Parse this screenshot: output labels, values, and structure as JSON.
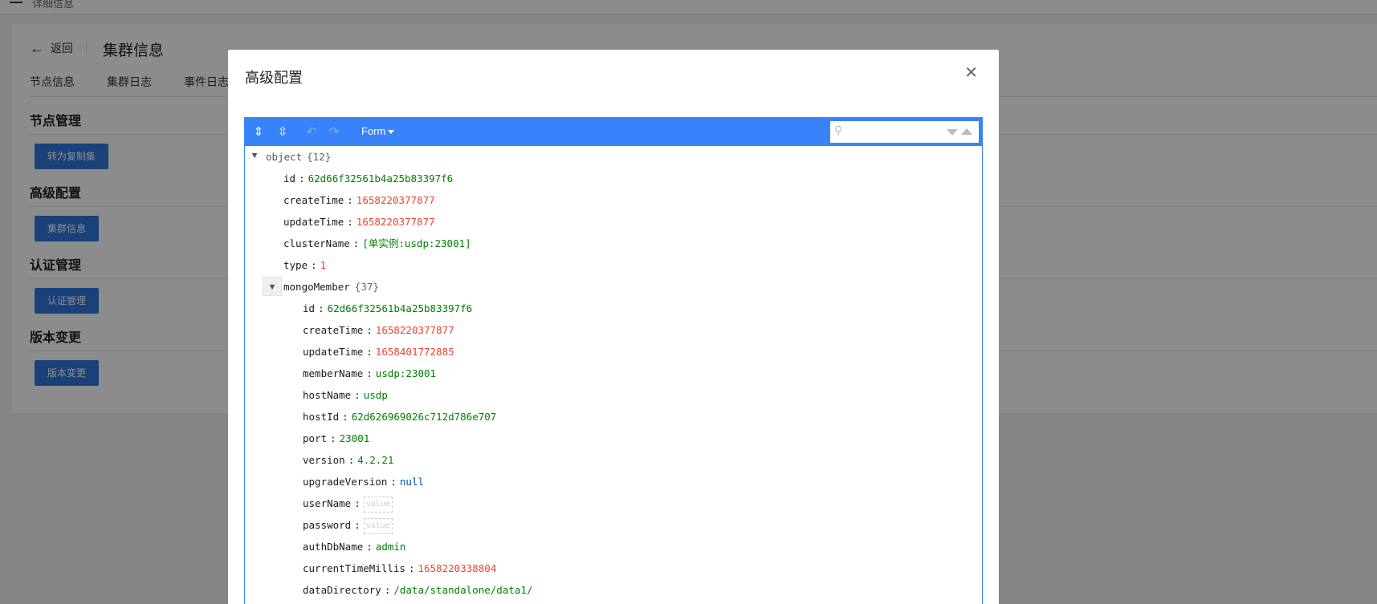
{
  "topbar": {
    "breadcrumb": "详细信息"
  },
  "page": {
    "back_label": "返回",
    "title": "集群信息",
    "tabs": [
      "节点信息",
      "集群日志",
      "事件日志"
    ],
    "sections": [
      {
        "title": "节点管理",
        "button": "转为复制集"
      },
      {
        "title": "高级配置",
        "button": "集群信息"
      },
      {
        "title": "认证管理",
        "button": "认证管理"
      },
      {
        "title": "版本变更",
        "button": "版本变更"
      }
    ]
  },
  "modal": {
    "title": "高级配置",
    "close_icon": "close-icon",
    "editor": {
      "mode_label": "Form",
      "colors": {
        "menu": "#3883fa",
        "string": "#008000",
        "number": "#ee422e",
        "null": "#004ed0"
      },
      "root": {
        "key": "object",
        "count": "{12}"
      },
      "fields": [
        {
          "key": "id",
          "value": "62d66f32561b4a25b83397f6",
          "type": "string"
        },
        {
          "key": "createTime",
          "value": "1658220377877",
          "type": "number"
        },
        {
          "key": "updateTime",
          "value": "1658220377877",
          "type": "number"
        },
        {
          "key": "clusterName",
          "value": "[单实例:usdp:23001]",
          "type": "string"
        },
        {
          "key": "type",
          "value": "1",
          "type": "number"
        }
      ],
      "member": {
        "key": "mongoMember",
        "count": "{37}",
        "fields": [
          {
            "key": "id",
            "value": "62d66f32561b4a25b83397f6",
            "type": "string"
          },
          {
            "key": "createTime",
            "value": "1658220377877",
            "type": "number"
          },
          {
            "key": "updateTime",
            "value": "1658401772885",
            "type": "number"
          },
          {
            "key": "memberName",
            "value": "usdp:23001",
            "type": "string"
          },
          {
            "key": "hostName",
            "value": "usdp",
            "type": "string"
          },
          {
            "key": "hostId",
            "value": "62d626969026c712d786e707",
            "type": "string"
          },
          {
            "key": "port",
            "value": "23001",
            "type": "string"
          },
          {
            "key": "version",
            "value": "4.2.21",
            "type": "string"
          },
          {
            "key": "upgradeVersion",
            "value": "null",
            "type": "null"
          },
          {
            "key": "userName",
            "value": "value",
            "type": "empty"
          },
          {
            "key": "password",
            "value": "value",
            "type": "empty"
          },
          {
            "key": "authDbName",
            "value": "admin",
            "type": "string"
          },
          {
            "key": "currentTimeMillis",
            "value": "1658220338804",
            "type": "number"
          },
          {
            "key": "dataDirectory",
            "value": "/data/standalone/data1/",
            "type": "string"
          }
        ]
      }
    }
  }
}
